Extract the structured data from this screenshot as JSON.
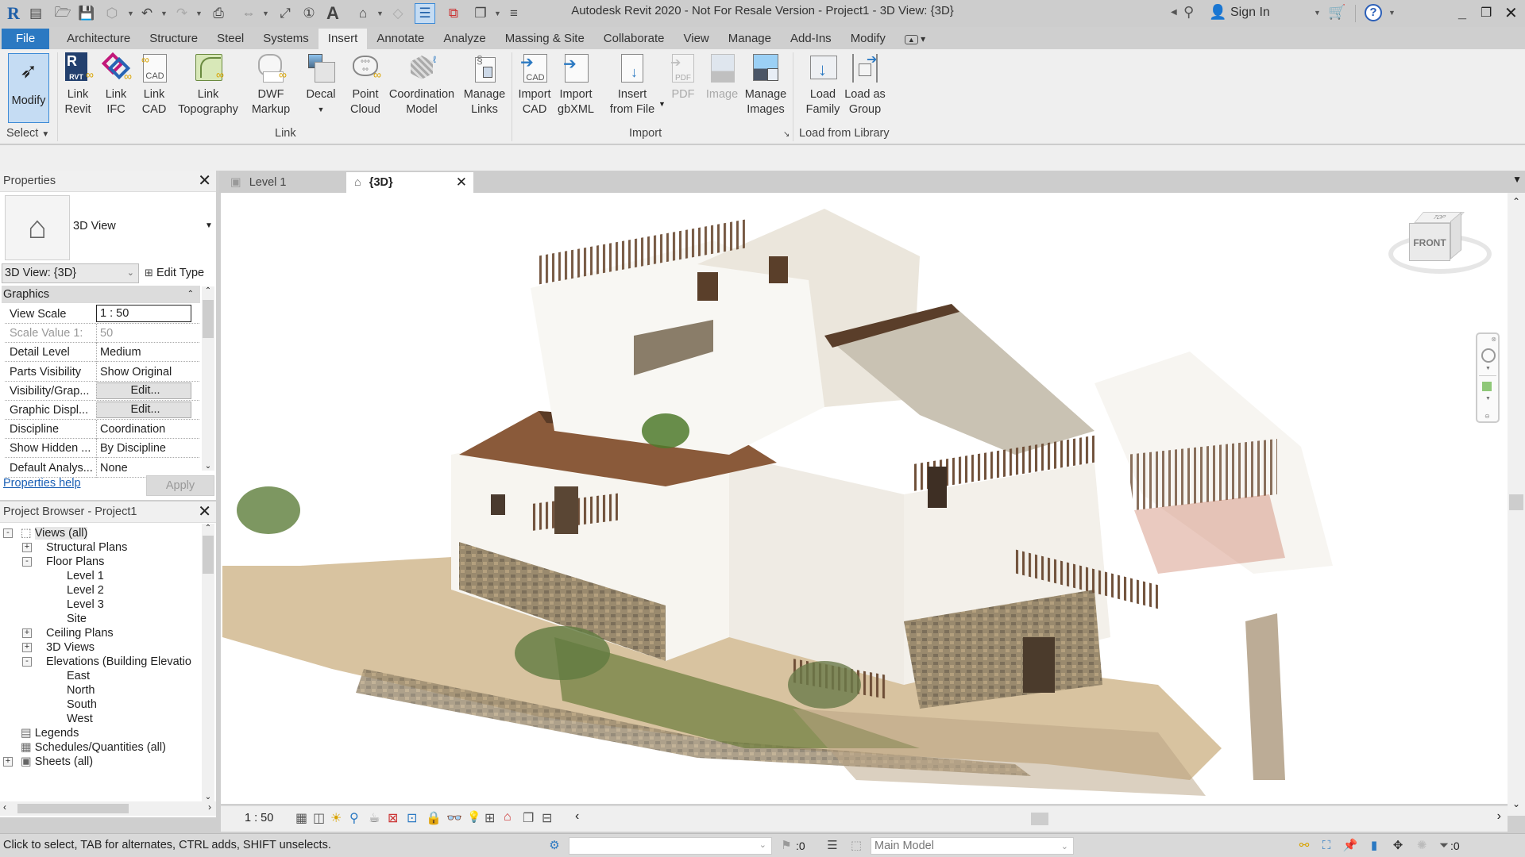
{
  "window": {
    "title": "Autodesk Revit 2020 - Not For Resale Version - Project1 - 3D View: {3D}",
    "sign_in": "Sign In",
    "controls": [
      "minimize",
      "restore",
      "close"
    ]
  },
  "quick_access": {
    "icons": [
      "revit-logo-icon",
      "recent-files-icon",
      "open-icon",
      "save-icon",
      "sync-icon",
      "undo-icon",
      "redo-icon",
      "print-icon",
      "measure-icon",
      "aligned-dimension-icon",
      "tag-icon",
      "text-icon",
      "default-3d-view-icon",
      "section-icon",
      "thin-lines-icon",
      "close-hidden-windows-icon",
      "switch-windows-icon",
      "customize-qat-icon"
    ]
  },
  "ribbon": {
    "tabs": [
      {
        "label": "File"
      },
      {
        "label": "Architecture"
      },
      {
        "label": "Structure"
      },
      {
        "label": "Steel"
      },
      {
        "label": "Systems"
      },
      {
        "label": "Insert",
        "active": true
      },
      {
        "label": "Annotate"
      },
      {
        "label": "Analyze"
      },
      {
        "label": "Massing & Site"
      },
      {
        "label": "Collaborate"
      },
      {
        "label": "View"
      },
      {
        "label": "Manage"
      },
      {
        "label": "Add-Ins"
      },
      {
        "label": "Modify"
      }
    ],
    "select": {
      "modify": "Modify",
      "label": "Select"
    },
    "panels": {
      "link": {
        "label": "Link",
        "buttons": [
          {
            "line1": "Link",
            "line2": "Revit"
          },
          {
            "line1": "Link",
            "line2": "IFC"
          },
          {
            "line1": "Link",
            "line2": "CAD"
          },
          {
            "line1": "Link",
            "line2": "Topography"
          },
          {
            "line1": "DWF",
            "line2": "Markup"
          },
          {
            "line1": "Decal",
            "line2": ""
          },
          {
            "line1": "Point",
            "line2": "Cloud"
          },
          {
            "line1": "Coordination",
            "line2": "Model"
          },
          {
            "line1": "Manage",
            "line2": "Links"
          }
        ]
      },
      "import": {
        "label": "Import",
        "buttons": [
          {
            "line1": "Import",
            "line2": "CAD"
          },
          {
            "line1": "Import",
            "line2": "gbXML"
          },
          {
            "line1": "Insert",
            "line2": "from File"
          },
          {
            "line1": "PDF",
            "line2": "",
            "disabled": true
          },
          {
            "line1": "Image",
            "line2": "",
            "disabled": true
          },
          {
            "line1": "Manage",
            "line2": "Images"
          }
        ]
      },
      "library": {
        "label": "Load from Library",
        "buttons": [
          {
            "line1": "Load",
            "line2": "Family"
          },
          {
            "line1": "Load as",
            "line2": "Group"
          }
        ]
      }
    }
  },
  "properties": {
    "title": "Properties",
    "type_name": "3D View",
    "instance_selector": "3D View: {3D}",
    "edit_type": "Edit Type",
    "group": "Graphics",
    "rows": [
      {
        "key": "View Scale",
        "value": "1 : 50",
        "kind": "input"
      },
      {
        "key": "Scale Value    1:",
        "value": "50",
        "kind": "disabled"
      },
      {
        "key": "Detail Level",
        "value": "Medium"
      },
      {
        "key": "Parts Visibility",
        "value": "Show Original"
      },
      {
        "key": "Visibility/Grap...",
        "value": "Edit...",
        "kind": "button"
      },
      {
        "key": "Graphic Displ...",
        "value": "Edit...",
        "kind": "button"
      },
      {
        "key": "Discipline",
        "value": "Coordination"
      },
      {
        "key": "Show Hidden ...",
        "value": "By Discipline"
      },
      {
        "key": "Default Analys...",
        "value": "None"
      }
    ],
    "help_link": "Properties help",
    "apply": "Apply"
  },
  "project_browser": {
    "title": "Project Browser - Project1",
    "nodes": [
      {
        "label": "Views (all)",
        "level": 0,
        "toggle": "-"
      },
      {
        "label": "Structural Plans",
        "level": 1,
        "toggle": "+"
      },
      {
        "label": "Floor Plans",
        "level": 1,
        "toggle": "-"
      },
      {
        "label": "Level 1",
        "level": 2
      },
      {
        "label": "Level 2",
        "level": 2
      },
      {
        "label": "Level 3",
        "level": 2
      },
      {
        "label": "Site",
        "level": 2
      },
      {
        "label": "Ceiling Plans",
        "level": 1,
        "toggle": "+"
      },
      {
        "label": "3D Views",
        "level": 1,
        "toggle": "+"
      },
      {
        "label": "Elevations (Building Elevatio",
        "level": 1,
        "toggle": "-"
      },
      {
        "label": "East",
        "level": 2
      },
      {
        "label": "North",
        "level": 2
      },
      {
        "label": "South",
        "level": 2
      },
      {
        "label": "West",
        "level": 2
      },
      {
        "label": "Legends",
        "level": 0
      },
      {
        "label": "Schedules/Quantities (all)",
        "level": 0
      },
      {
        "label": "Sheets (all)",
        "level": 0,
        "toggle": "+"
      }
    ]
  },
  "view_tabs": [
    {
      "label": "Level 1",
      "active": false
    },
    {
      "label": "{3D}",
      "active": true
    }
  ],
  "viewcube": {
    "front": "FRONT",
    "top": "TOP"
  },
  "view_control_bar": {
    "scale": "1 : 50"
  },
  "status_bar": {
    "message": "Click to select, TAB for alternates, CTRL adds, SHIFT unselects.",
    "workset_value": "",
    "selection_count": ":0",
    "design_option": "Main Model",
    "filter_count": ":0"
  },
  "colors": {
    "file_tab": "#2b79c2",
    "ribbon_bg": "#efefef",
    "chrome_bg": "#cdcdcd",
    "selection": "#c5dcf3",
    "link": "#1a5fb4"
  }
}
